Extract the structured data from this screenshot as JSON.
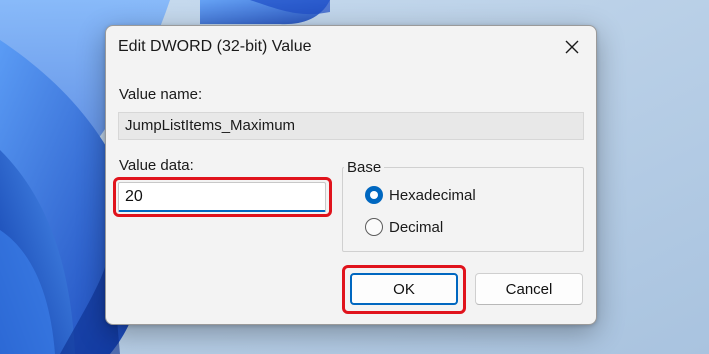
{
  "dialog": {
    "title": "Edit DWORD (32-bit) Value",
    "value_name_label": "Value name:",
    "value_name": "JumpListItems_Maximum",
    "value_data_label": "Value data:",
    "value_data": "20",
    "base": {
      "legend": "Base",
      "options": [
        {
          "label": "Hexadecimal",
          "selected": true
        },
        {
          "label": "Decimal",
          "selected": false
        }
      ]
    },
    "buttons": {
      "ok": "OK",
      "cancel": "Cancel"
    }
  },
  "icons": {
    "close": "close-icon"
  },
  "colors": {
    "accent": "#0067c0",
    "highlight_annotation": "#e0131c",
    "dialog_background": "#f3f3f3",
    "wallpaper_blue": "#2a5fd4"
  }
}
